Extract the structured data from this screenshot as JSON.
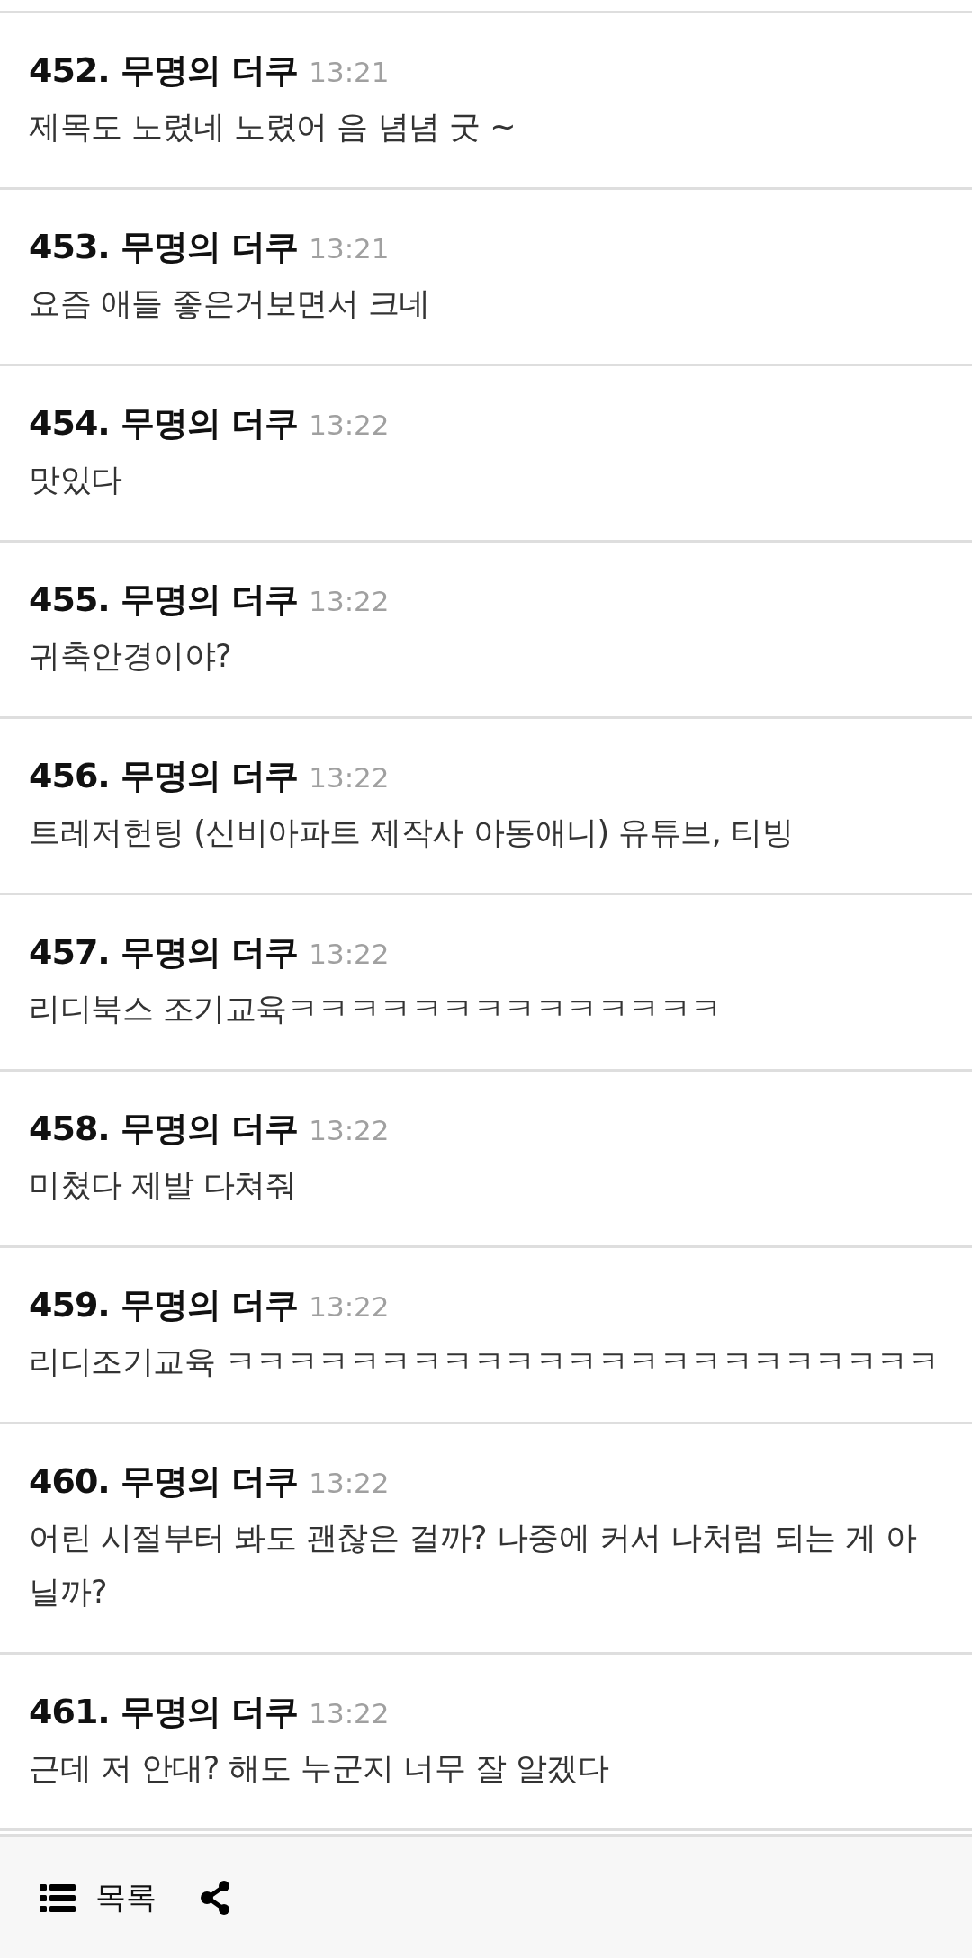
{
  "comments": [
    {
      "number": "452.",
      "author": "무명의 더쿠",
      "time": "13:21",
      "text": "제목도 노렸네 노렸어 음 념념 굿 ~"
    },
    {
      "number": "453.",
      "author": "무명의 더쿠",
      "time": "13:21",
      "text": "요즘 애들 좋은거보면서 크네"
    },
    {
      "number": "454.",
      "author": "무명의 더쿠",
      "time": "13:22",
      "text": "맛있다"
    },
    {
      "number": "455.",
      "author": "무명의 더쿠",
      "time": "13:22",
      "text": "귀축안경이야?"
    },
    {
      "number": "456.",
      "author": "무명의 더쿠",
      "time": "13:22",
      "text": "트레저헌팅 (신비아파트 제작사 아동애니) 유튜브, 티빙"
    },
    {
      "number": "457.",
      "author": "무명의 더쿠",
      "time": "13:22",
      "text": "리디북스 조기교육ㅋㅋㅋㅋㅋㅋㅋㅋㅋㅋㅋㅋㅋㅋ"
    },
    {
      "number": "458.",
      "author": "무명의 더쿠",
      "time": "13:22",
      "text": "미쳤다 제발 다쳐줘"
    },
    {
      "number": "459.",
      "author": "무명의 더쿠",
      "time": "13:22",
      "text": "리디조기교육 ㅋㅋㅋㅋㅋㅋㅋㅋㅋㅋㅋㅋㅋㅋㅋㅋㅋㅋㅋㅋㅋㅋㅋ"
    },
    {
      "number": "460.",
      "author": "무명의 더쿠",
      "time": "13:22",
      "text": "어린 시절부터 봐도 괜찮은 걸까? 나중에 커서 나처럼 되는 게 아닐까?"
    },
    {
      "number": "461.",
      "author": "무명의 더쿠",
      "time": "13:22",
      "text": "근데 저 안대? 해도 누군지 너무 잘 알겠다"
    }
  ],
  "bottom_bar": {
    "list_button": "목록"
  }
}
